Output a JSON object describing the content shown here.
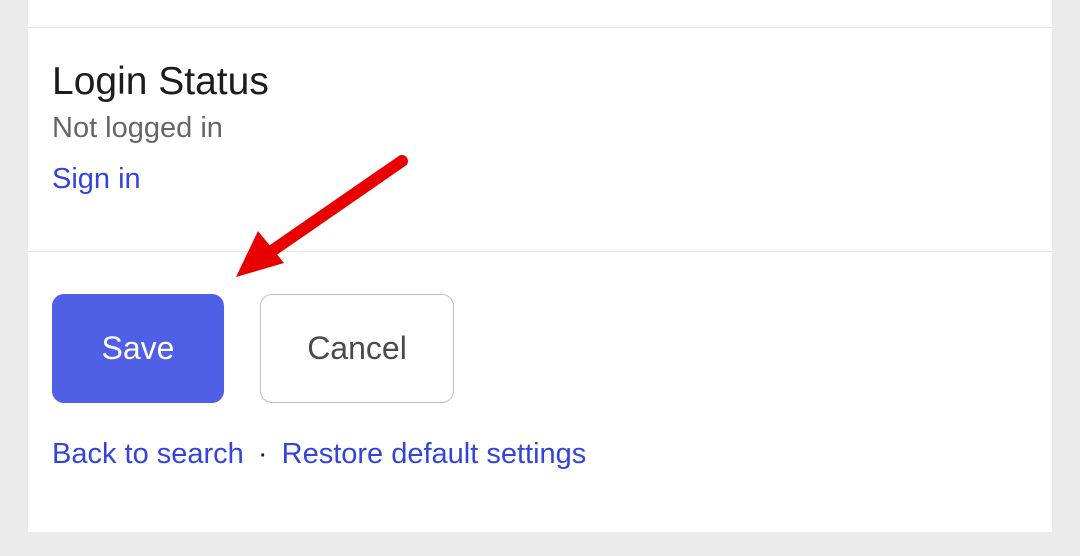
{
  "login": {
    "title": "Login Status",
    "status": "Not logged in",
    "sign_in_label": "Sign in"
  },
  "actions": {
    "save_label": "Save",
    "cancel_label": "Cancel"
  },
  "footer": {
    "back_to_search_label": "Back to search",
    "separator": "·",
    "restore_defaults_label": "Restore default settings"
  },
  "annotation": {
    "arrow_color": "#e80000"
  }
}
